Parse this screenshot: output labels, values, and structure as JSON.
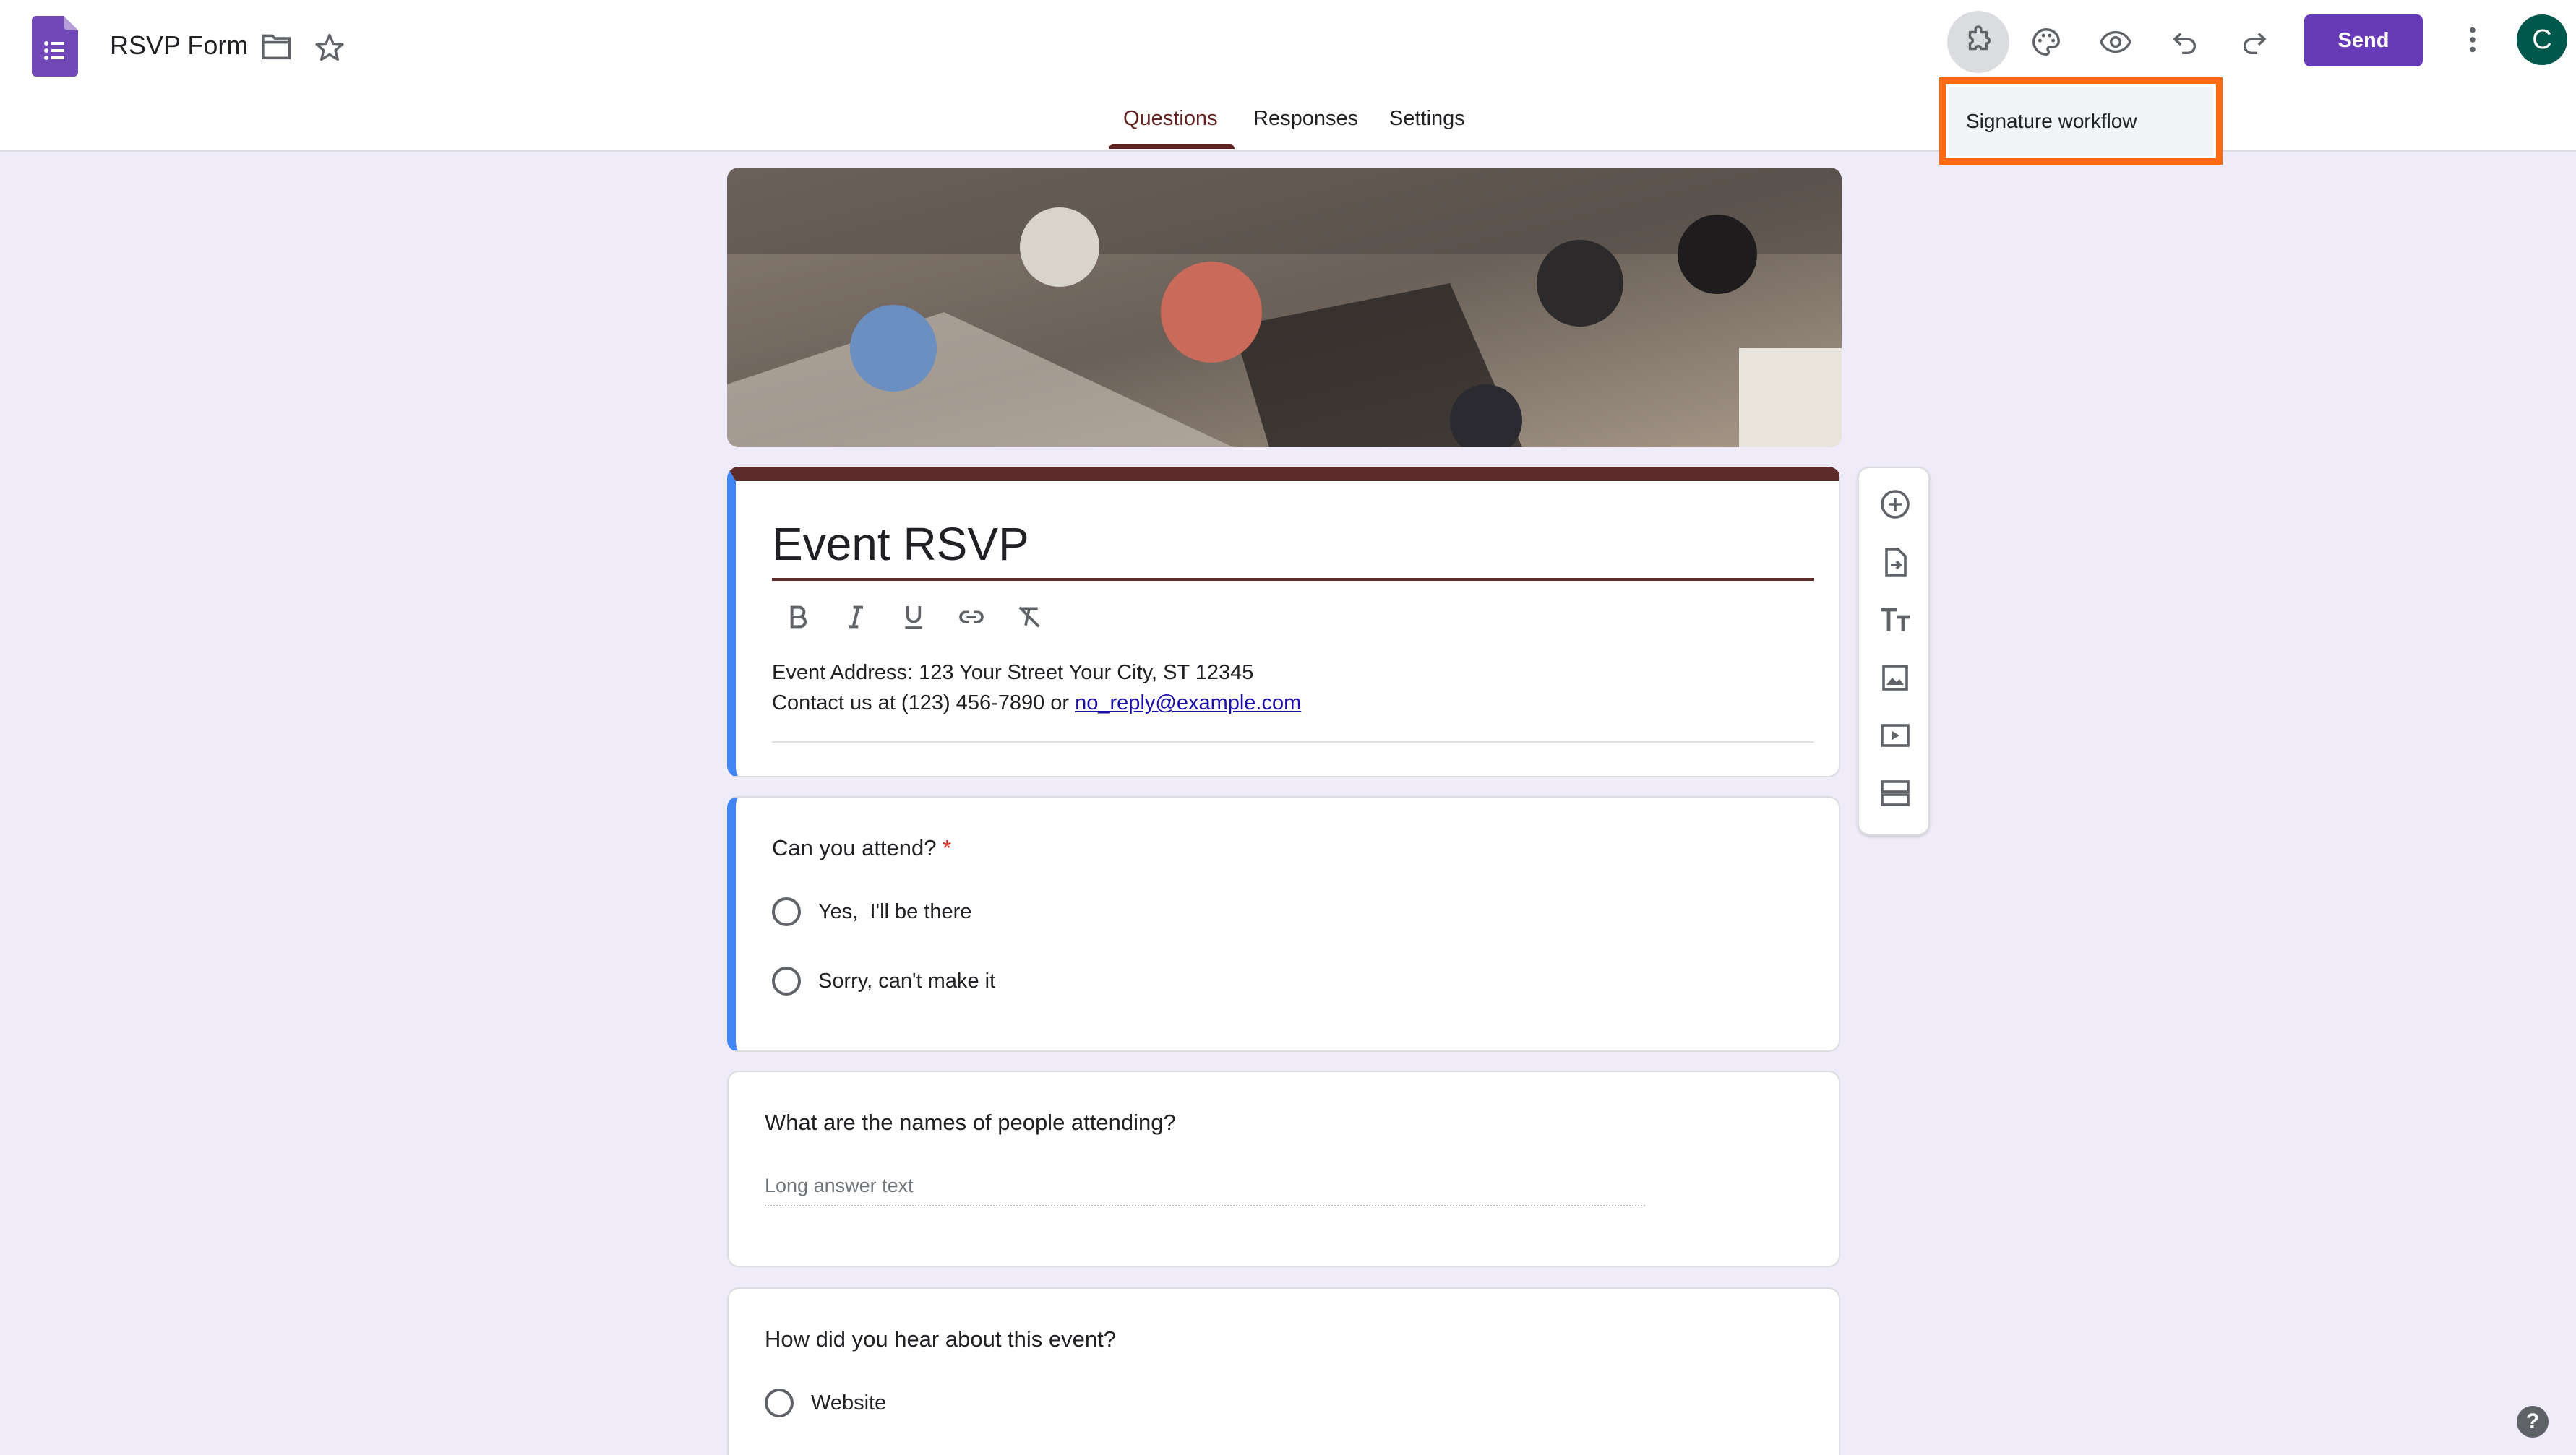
{
  "header": {
    "doc_title": "RSVP Form",
    "send_label": "Send",
    "avatar_letter": "C",
    "icons": [
      "forms-logo-icon",
      "folder-icon",
      "star-icon",
      "add-ons-icon",
      "palette-icon",
      "preview-eye-icon",
      "undo-icon",
      "redo-icon",
      "more-vert-icon"
    ]
  },
  "tabs": [
    {
      "label": "Questions",
      "active": true
    },
    {
      "label": "Responses",
      "active": false
    },
    {
      "label": "Settings",
      "active": false
    }
  ],
  "addon_menu": {
    "item_label": "Signature workflow",
    "highlight_color": "#ff6a13"
  },
  "form": {
    "title": "Event RSVP",
    "description_line1": "Event Address: 123 Your Street Your City, ST 12345",
    "description_line2_prefix": "Contact us at (123) 456-7890 or ",
    "description_email": "no_reply@example.com",
    "theme_color": "#5c2b2a",
    "accent_color": "#4285f4"
  },
  "questions": [
    {
      "title": "Can you attend?",
      "required_mark": "*",
      "options": [
        "Yes,  I'll be there",
        "Sorry, can't make it"
      ]
    },
    {
      "title": "What are the names of people attending?",
      "placeholder": "Long answer text"
    },
    {
      "title": "How did you hear about this event?",
      "options": [
        "Website"
      ]
    }
  ],
  "side_toolbar": [
    "add-question-icon",
    "import-questions-icon",
    "add-title-icon",
    "add-image-icon",
    "add-video-icon",
    "add-section-icon"
  ],
  "help_label": "?"
}
